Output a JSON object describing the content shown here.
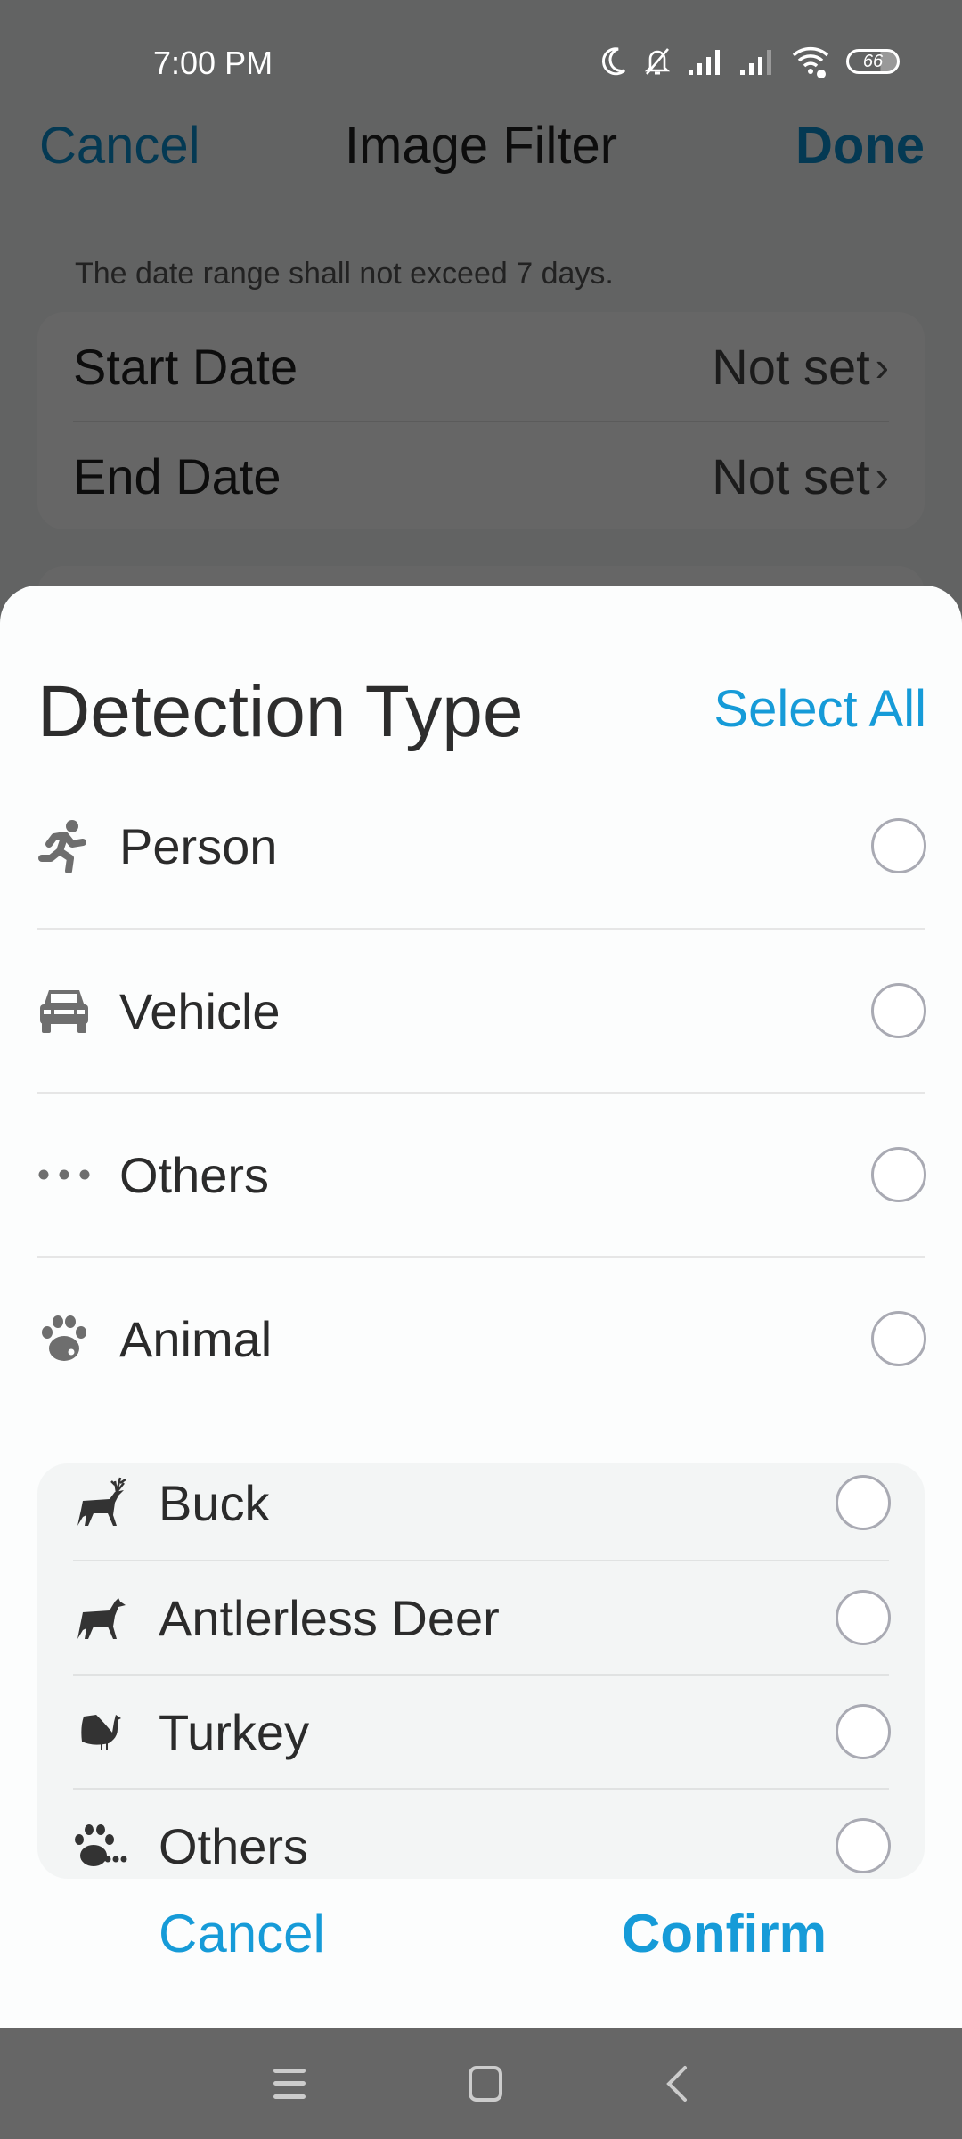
{
  "status_bar": {
    "time": "7:00 PM",
    "icons": [
      "moon-icon",
      "bell-off-icon",
      "signal-icon",
      "signal-weak-icon",
      "wifi-icon"
    ],
    "battery": "66"
  },
  "header": {
    "cancel_label": "Cancel",
    "title": "Image Filter",
    "done_label": "Done"
  },
  "date_section": {
    "hint": "The date range shall not exceed 7 days.",
    "rows": [
      {
        "label": "Start Date",
        "value": "Not set"
      },
      {
        "label": "End Date",
        "value": "Not set"
      }
    ]
  },
  "sheet": {
    "title": "Detection Type",
    "select_all_label": "Select All",
    "items": [
      {
        "label": "Person",
        "icon": "running-person-icon",
        "selected": false
      },
      {
        "label": "Vehicle",
        "icon": "car-icon",
        "selected": false
      },
      {
        "label": "Others",
        "icon": "more-dots-icon",
        "selected": false
      },
      {
        "label": "Animal",
        "icon": "paw-icon",
        "selected": false
      }
    ],
    "animal_sub_items": [
      {
        "label": "Buck",
        "icon": "buck-icon",
        "selected": false
      },
      {
        "label": "Antlerless Deer",
        "icon": "doe-icon",
        "selected": false
      },
      {
        "label": "Turkey",
        "icon": "turkey-icon",
        "selected": false
      },
      {
        "label": "Others",
        "icon": "paw-more-icon",
        "selected": false
      }
    ],
    "cancel_label": "Cancel",
    "confirm_label": "Confirm"
  },
  "colors": {
    "accent": "#169bd8",
    "text": "#2b2b2b",
    "sysnav": "#666666"
  }
}
